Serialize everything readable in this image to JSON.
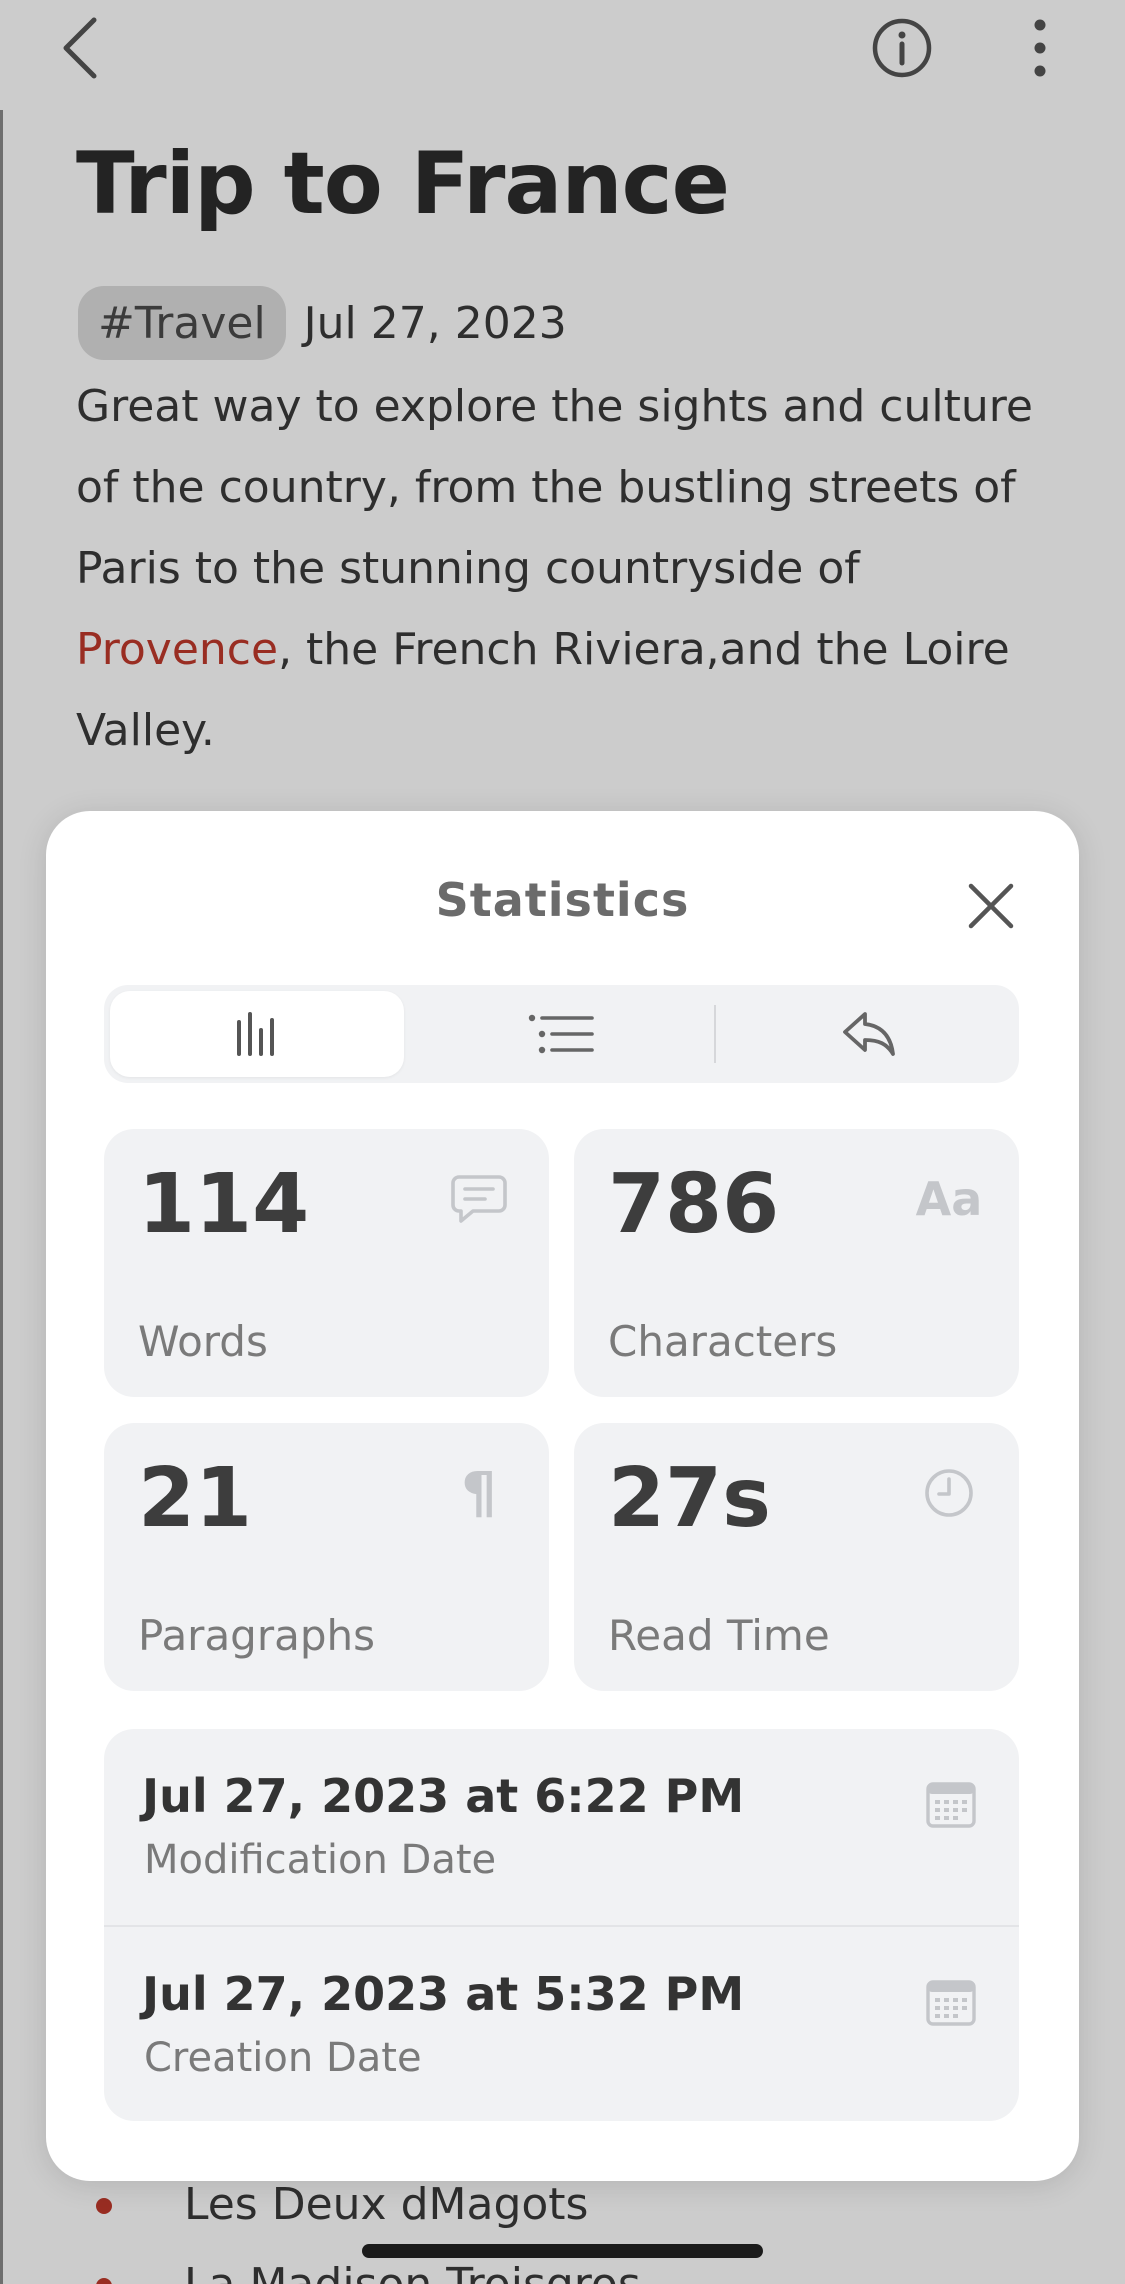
{
  "note": {
    "title": "Trip to France",
    "tag": "#Travel",
    "date": "Jul 27, 2023",
    "body": {
      "line1": "Great way to explore the sights and culture",
      "line2": "of the country, from the bustling streets of",
      "line3": "Paris to the stunning countryside of",
      "line4_link": "Provence",
      "line4_rest": ", the French Riviera,and the Loire",
      "line5": "Valley."
    },
    "bullets": [
      "Les Deux dMagots",
      "La Madison Troisgros"
    ]
  },
  "toolbar": {
    "back_icon": "chevron-left-icon",
    "info_icon": "info-circle-icon",
    "more_icon": "more-vertical-icon"
  },
  "statistics": {
    "title": "Statistics",
    "tabs": [
      {
        "icon": "bar-chart-icon",
        "selected": true
      },
      {
        "icon": "list-icon",
        "selected": false
      },
      {
        "icon": "reply-icon",
        "selected": false
      }
    ],
    "cards": [
      {
        "value": "114",
        "label": "Words",
        "icon": "comment-icon"
      },
      {
        "value": "786",
        "label": "Characters",
        "icon": "text-aa-icon",
        "glyph": "Aa"
      },
      {
        "value": "21",
        "label": "Paragraphs",
        "icon": "pilcrow-icon",
        "glyph": "¶"
      },
      {
        "value": "27s",
        "label": "Read Time",
        "icon": "clock-icon"
      }
    ],
    "dates": [
      {
        "value": "Jul 27, 2023 at 6:22 PM",
        "label": "Modification Date",
        "icon": "calendar-icon"
      },
      {
        "value": "Jul 27, 2023 at 5:32 PM",
        "label": "Creation Date",
        "icon": "calendar-icon"
      }
    ]
  },
  "colors": {
    "accent_red": "#c0392b",
    "card_bg": "#f1f2f4",
    "icon_gray": "#c4c6ca"
  }
}
